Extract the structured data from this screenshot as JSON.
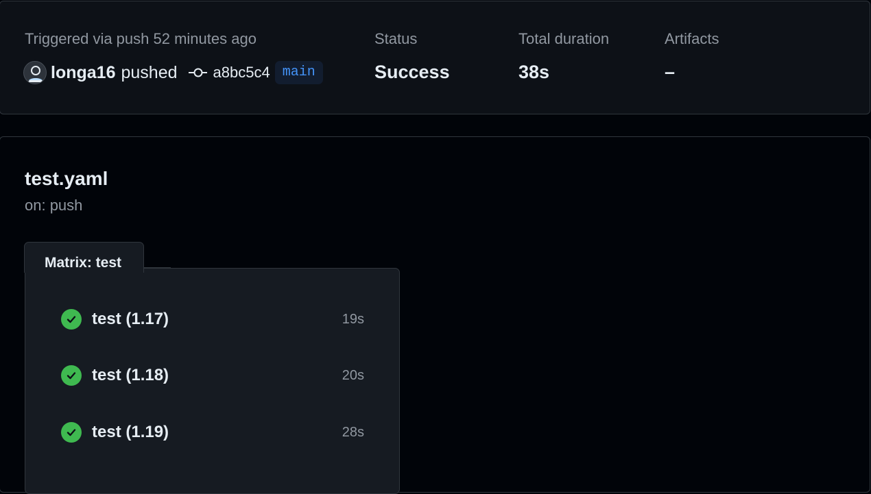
{
  "run": {
    "trigger_text": "Triggered via push 52 minutes ago",
    "actor": "longa16",
    "action": "pushed",
    "commit_sha": "a8bc5c4",
    "branch": "main",
    "icons": {
      "avatar": "user-avatar-icon",
      "commit": "git-commit-icon"
    }
  },
  "stats": {
    "status_label": "Status",
    "status_value": "Success",
    "duration_label": "Total duration",
    "duration_value": "38s",
    "artifacts_label": "Artifacts",
    "artifacts_value": "–"
  },
  "workflow": {
    "file": "test.yaml",
    "trigger": "on: push",
    "matrix_label": "Matrix: test",
    "jobs": [
      {
        "name": "test (1.17)",
        "duration": "19s",
        "status": "success"
      },
      {
        "name": "test (1.18)",
        "duration": "20s",
        "status": "success"
      },
      {
        "name": "test (1.19)",
        "duration": "28s",
        "status": "success"
      }
    ]
  },
  "colors": {
    "success": "#3fb950",
    "branch_text": "#4493f8",
    "branch_bg": "#121d2f",
    "panel_bg": "#0d1117",
    "page_bg": "#010409"
  }
}
